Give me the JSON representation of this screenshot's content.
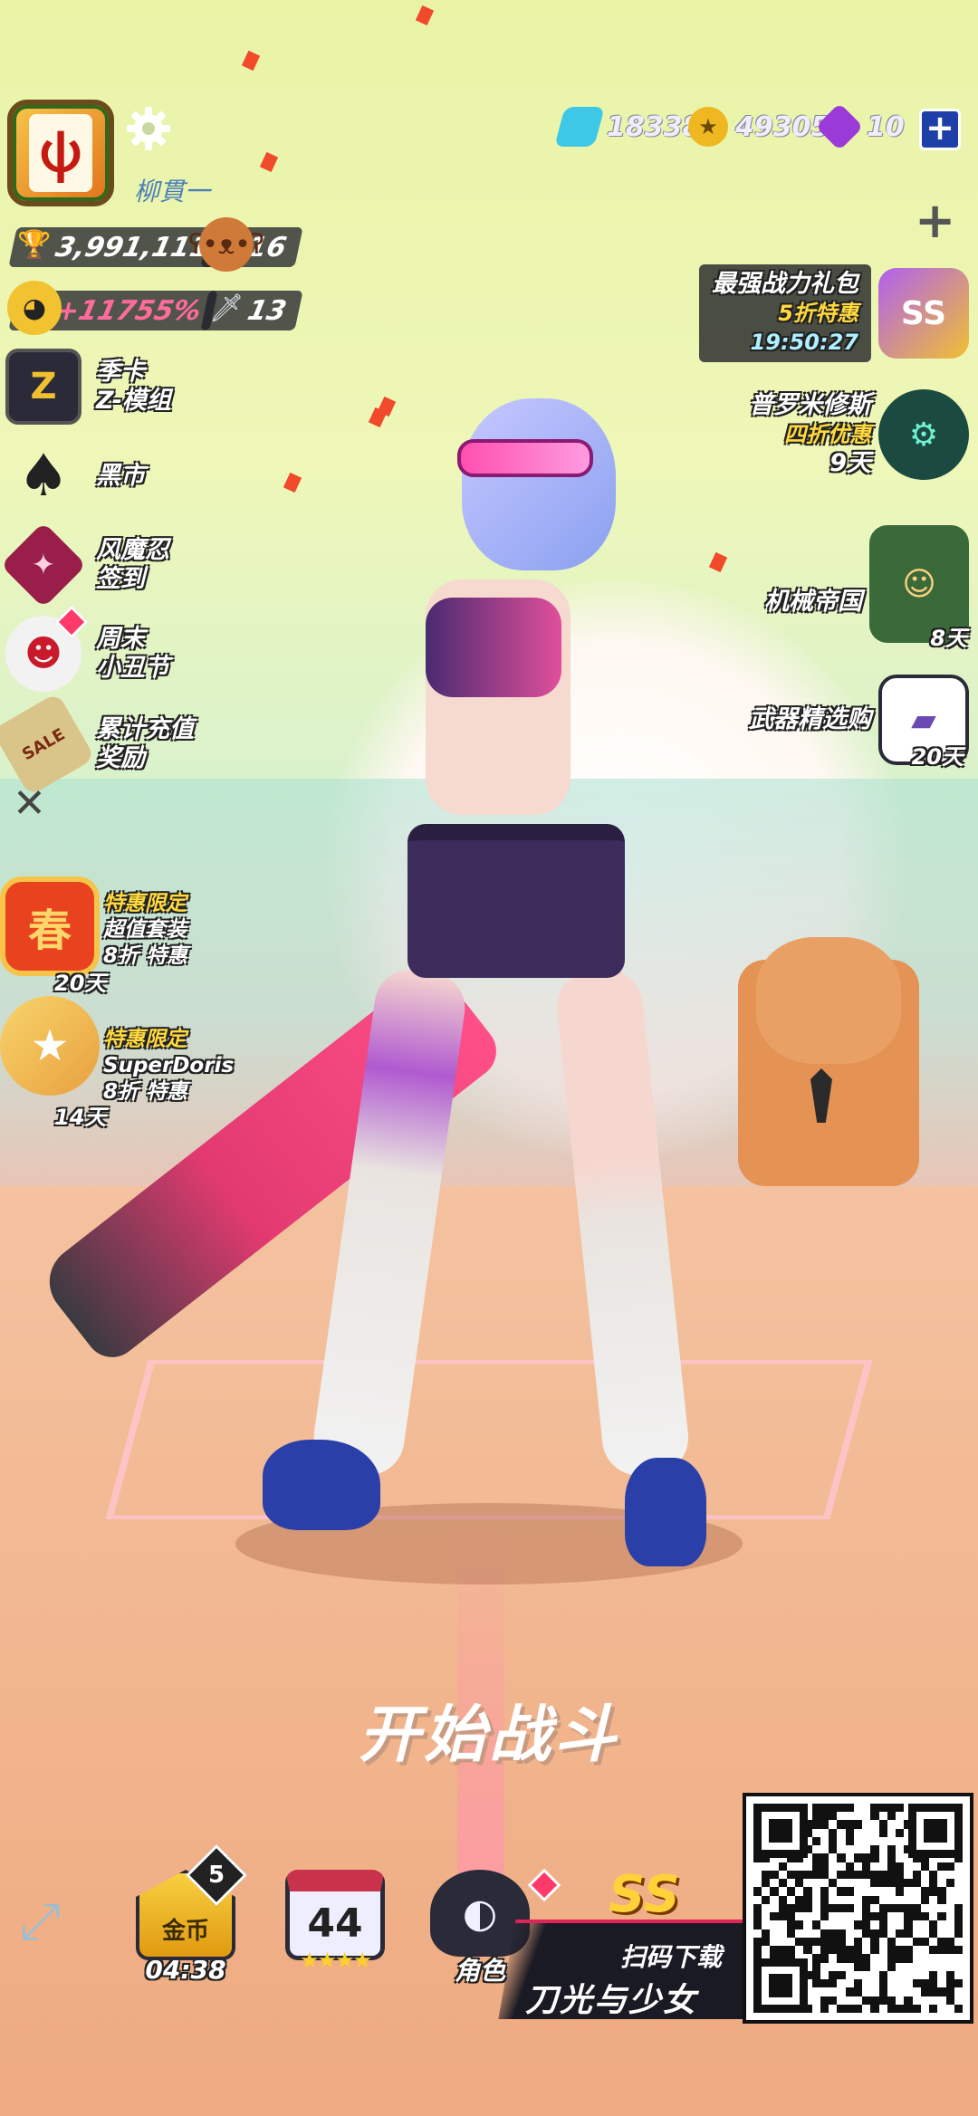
{
  "player": {
    "name": "柳貫一",
    "trophies": "3,991,111",
    "bear_count": "16",
    "power_bonus": "+11755%",
    "weapon_count": "13"
  },
  "currencies": [
    {
      "icon": "diamond-icon",
      "value": "18338",
      "color": "#3ec8e8"
    },
    {
      "icon": "gold-coin-icon",
      "value": "49305",
      "color": "#f0b820"
    },
    {
      "icon": "purple-gem-icon",
      "value": "10",
      "color": "#9a3ad8"
    }
  ],
  "left_menu": [
    {
      "name": "season-card",
      "icon": "z-module-icon",
      "glyph": "Z",
      "label_1": "季卡",
      "label_2": "Z-模组"
    },
    {
      "name": "black-market",
      "icon": "spade-ace-icon",
      "glyph": "♠",
      "label_1": "黑市",
      "label_2": ""
    },
    {
      "name": "wind-ninja-signin",
      "icon": "ninja-star-icon",
      "glyph": "✦",
      "label_1": "风魔忍",
      "label_2": "签到"
    },
    {
      "name": "weekend-clown",
      "icon": "clown-icon",
      "glyph": "☻",
      "label_1": "周末",
      "label_2": "小丑节"
    },
    {
      "name": "cumulative-topup",
      "icon": "sale-tag-icon",
      "glyph": "SALE",
      "label_1": "累计充值",
      "label_2": "奖励"
    }
  ],
  "left_promos": [
    {
      "badge": "春",
      "line_1": "特惠限定",
      "line_2": "超值套装",
      "line_3": "8折 特惠",
      "days": "20天"
    },
    {
      "badge": "★",
      "line_1": "特惠限定",
      "line_2": "SuperDoris",
      "line_3": "8折 特惠",
      "days": "14天"
    }
  ],
  "right_events": [
    {
      "name": "strongest-pack",
      "title": "最强战力礼包",
      "sub": "5折特惠",
      "timer": "19:50:27",
      "days": "",
      "glyph": "SS"
    },
    {
      "name": "prometheus",
      "title": "普罗米修斯",
      "sub": "四折优惠",
      "timer": "",
      "days": "9天",
      "glyph": "⚙"
    },
    {
      "name": "mech-empire",
      "title": "机械帝国",
      "sub": "",
      "timer": "",
      "days": "8天",
      "glyph": "☺"
    },
    {
      "name": "weapon-select",
      "title": "武器精选购",
      "sub": "",
      "timer": "",
      "days": "20天",
      "glyph": "▰"
    }
  ],
  "start_label": "开始战斗",
  "bottom_bar": {
    "gold": {
      "label": "金币",
      "timer": "04:38",
      "badge": "5"
    },
    "level": {
      "value": "44",
      "stars": "★★★★"
    },
    "character": {
      "label": "角色"
    },
    "ss_label": "SS"
  },
  "download": {
    "title": "扫码下载",
    "game_name": "刀光与少女"
  }
}
